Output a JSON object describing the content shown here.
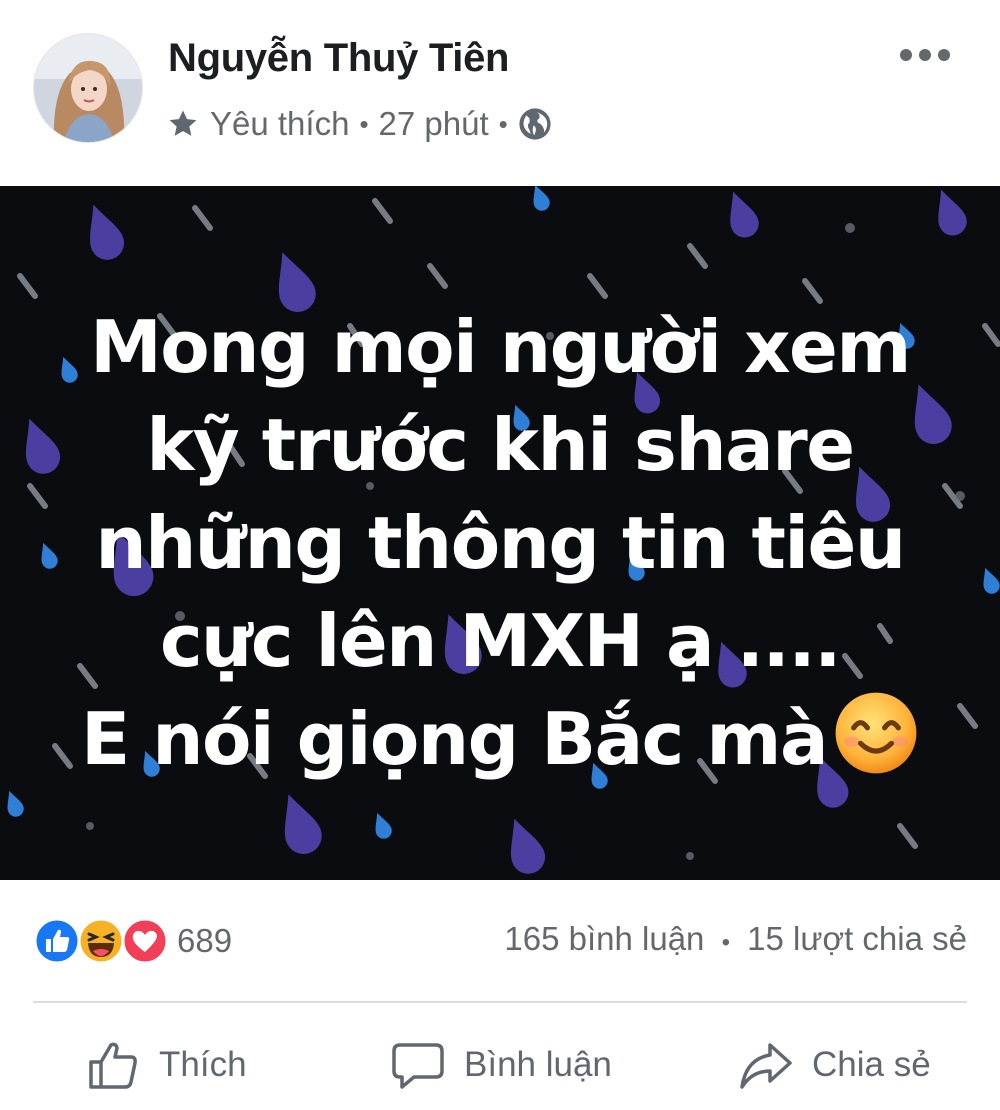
{
  "post": {
    "author": "Nguyễn Thuỷ Tiên",
    "audience": "Yêu thích",
    "time": "27 phút",
    "separator": "•",
    "icons": [
      "star-icon",
      "globe-icon",
      "more-icon"
    ]
  },
  "image": {
    "lines": [
      "Mong mọi người xem",
      "kỹ trước khi share",
      "những thông tin tiêu",
      "cực lên MXH ạ ....",
      "E nói giọng Bắc mà"
    ],
    "emoji": "smiling-face-icon",
    "background_color": "#0b0c10",
    "drop_colors": [
      "#4a3ea0",
      "#2f7fd6",
      "#9aa0aa"
    ]
  },
  "engagement": {
    "reaction_icons": [
      "like-icon",
      "haha-icon",
      "love-icon"
    ],
    "reaction_count": "689",
    "comments": "165 bình luận",
    "shares": "15 lượt chia sẻ",
    "separator": "•"
  },
  "actions": {
    "like": "Thích",
    "comment": "Bình luận",
    "share": "Chia sẻ"
  },
  "colors": {
    "like_blue": "#1877f2",
    "love_red": "#f33e58",
    "haha_yellow": "#f7b125",
    "secondary_text": "#65676b"
  }
}
